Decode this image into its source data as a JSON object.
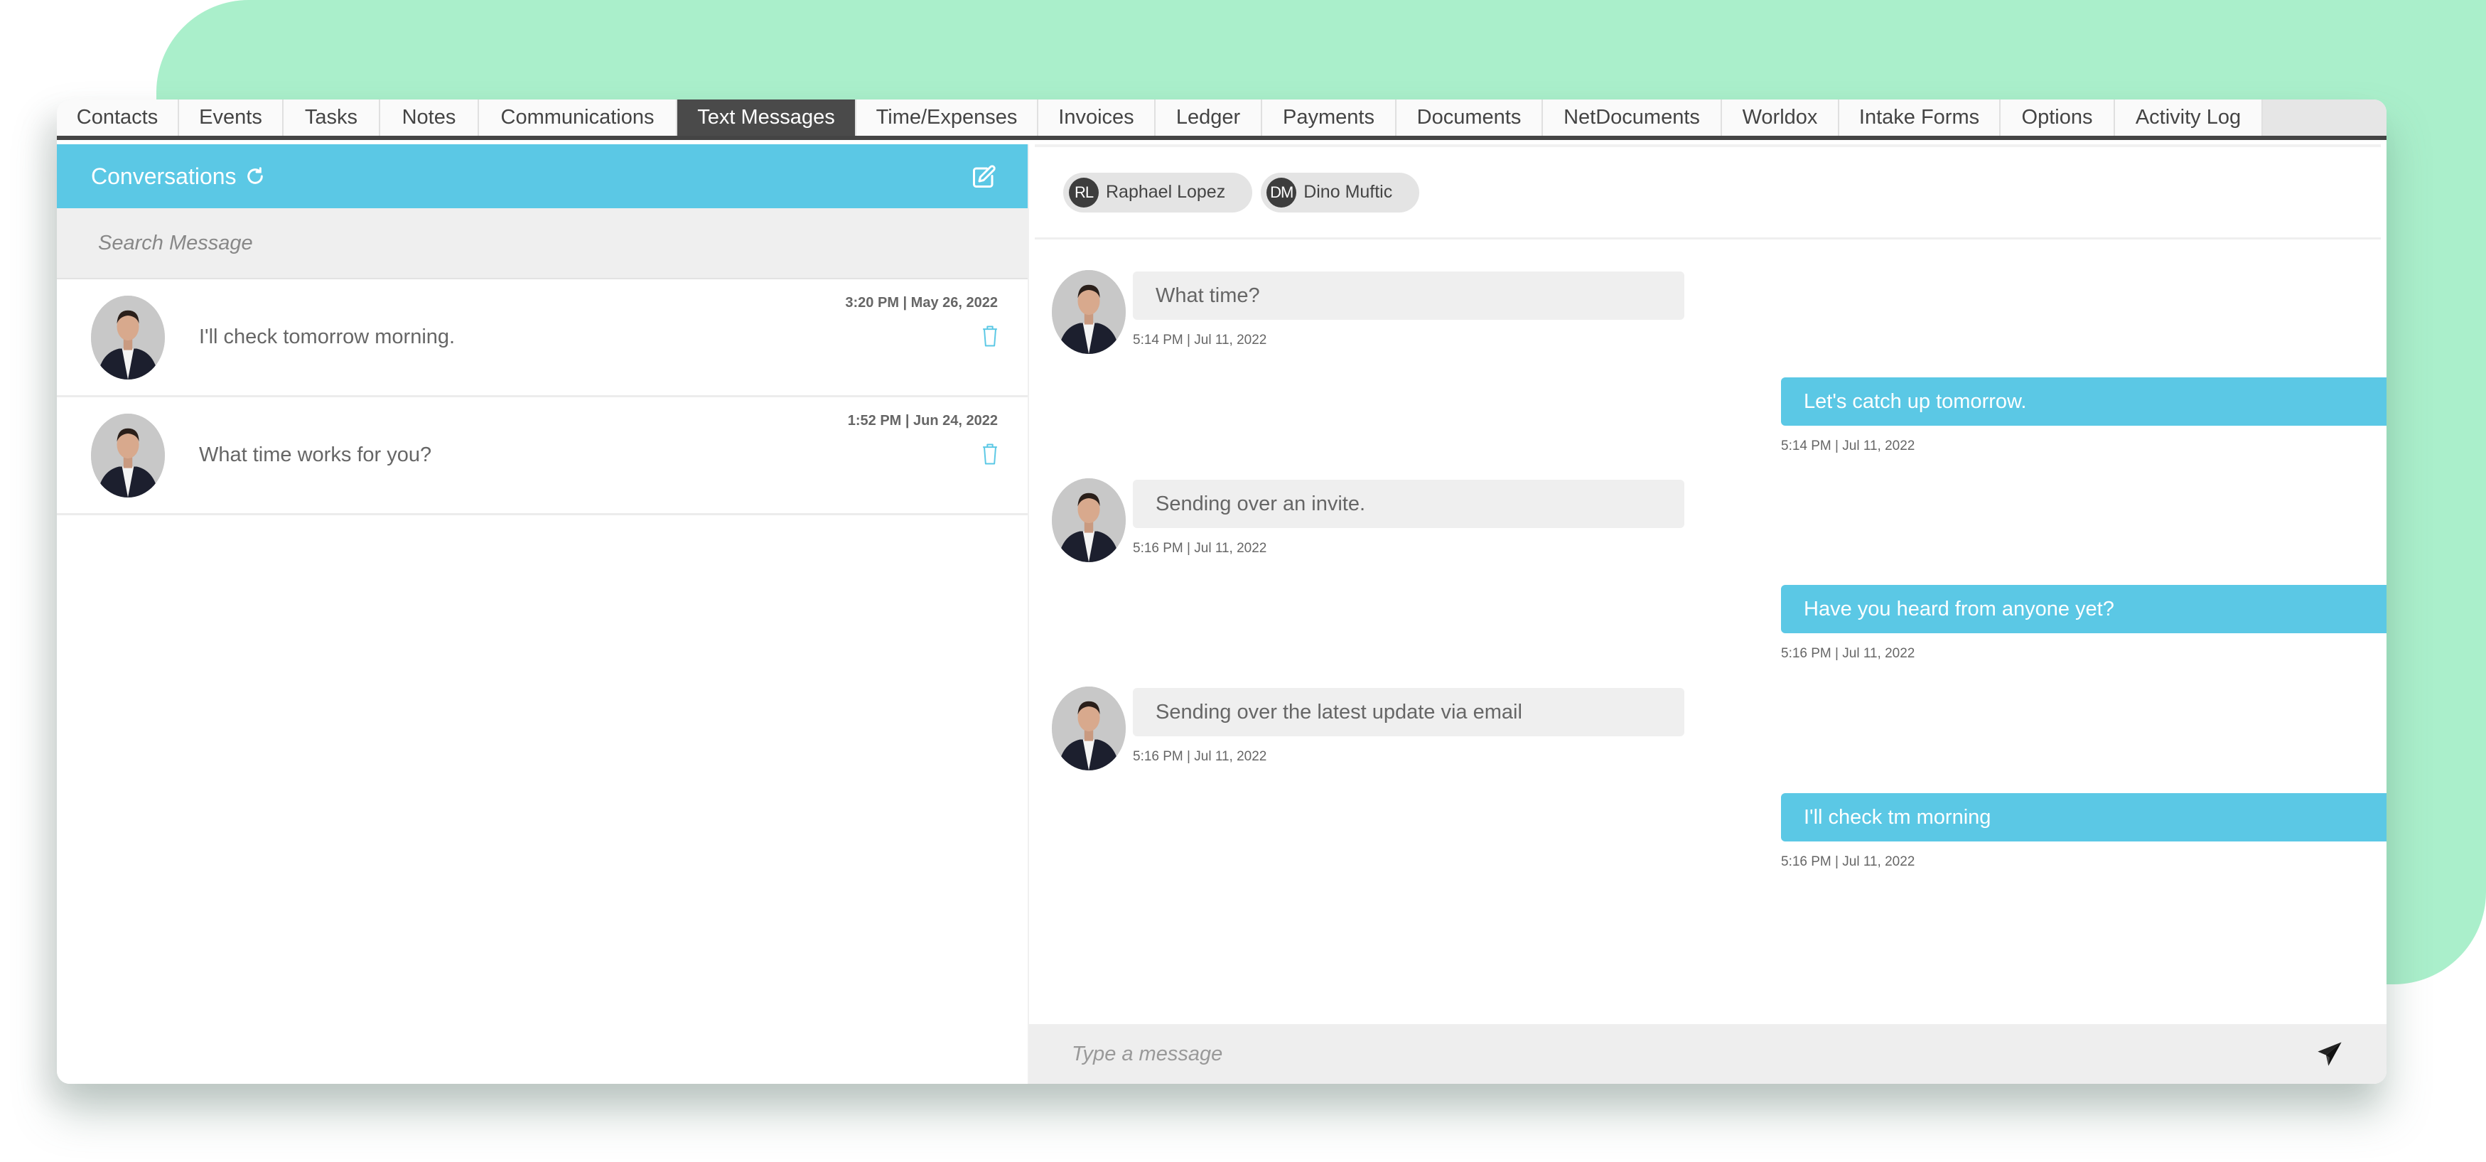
{
  "tabs": [
    {
      "label": "Contacts",
      "active": false
    },
    {
      "label": "Events",
      "active": false
    },
    {
      "label": "Tasks",
      "active": false
    },
    {
      "label": "Notes",
      "active": false
    },
    {
      "label": "Communications",
      "active": false
    },
    {
      "label": "Text Messages",
      "active": true
    },
    {
      "label": "Time/Expenses",
      "active": false
    },
    {
      "label": "Invoices",
      "active": false
    },
    {
      "label": "Ledger",
      "active": false
    },
    {
      "label": "Payments",
      "active": false
    },
    {
      "label": "Documents",
      "active": false
    },
    {
      "label": "NetDocuments",
      "active": false
    },
    {
      "label": "Worldox",
      "active": false
    },
    {
      "label": "Intake Forms",
      "active": false
    },
    {
      "label": "Options",
      "active": false
    },
    {
      "label": "Activity Log",
      "active": false
    }
  ],
  "conversations": {
    "title": "Conversations",
    "refresh_icon": "refresh-icon",
    "compose_icon": "edit-icon",
    "search_placeholder": "Search Message",
    "items": [
      {
        "preview": "I'll check tomorrow morning.",
        "time": "3:20 PM | May 26, 2022"
      },
      {
        "preview": "What time works for you?",
        "time": "1:52 PM | Jun 24, 2022"
      }
    ]
  },
  "chat": {
    "participants": [
      {
        "initials": "RL",
        "name": "Raphael Lopez"
      },
      {
        "initials": "DM",
        "name": "Dino Muftic"
      }
    ],
    "messages": [
      {
        "direction": "in",
        "text": "What time?",
        "time": "5:14 PM | Jul 11, 2022"
      },
      {
        "direction": "out",
        "text": "Let's catch up tomorrow.",
        "time": "5:14 PM | Jul 11, 2022"
      },
      {
        "direction": "in",
        "text": "Sending over an invite.",
        "time": "5:16 PM | Jul 11, 2022"
      },
      {
        "direction": "out",
        "text": "Have you heard from anyone yet?",
        "time": "5:16 PM | Jul 11, 2022"
      },
      {
        "direction": "in",
        "text": "Sending over the latest update via email",
        "time": "5:16 PM | Jul 11, 2022"
      },
      {
        "direction": "out",
        "text": "I'll check tm morning",
        "time": "5:16 PM | Jul 11, 2022"
      }
    ],
    "composer_placeholder": "Type a message",
    "send_icon": "send-icon"
  },
  "colors": {
    "accent": "#5bc8e5",
    "active_tab": "#4a4a4a",
    "background_shape": "#aaefcb"
  }
}
